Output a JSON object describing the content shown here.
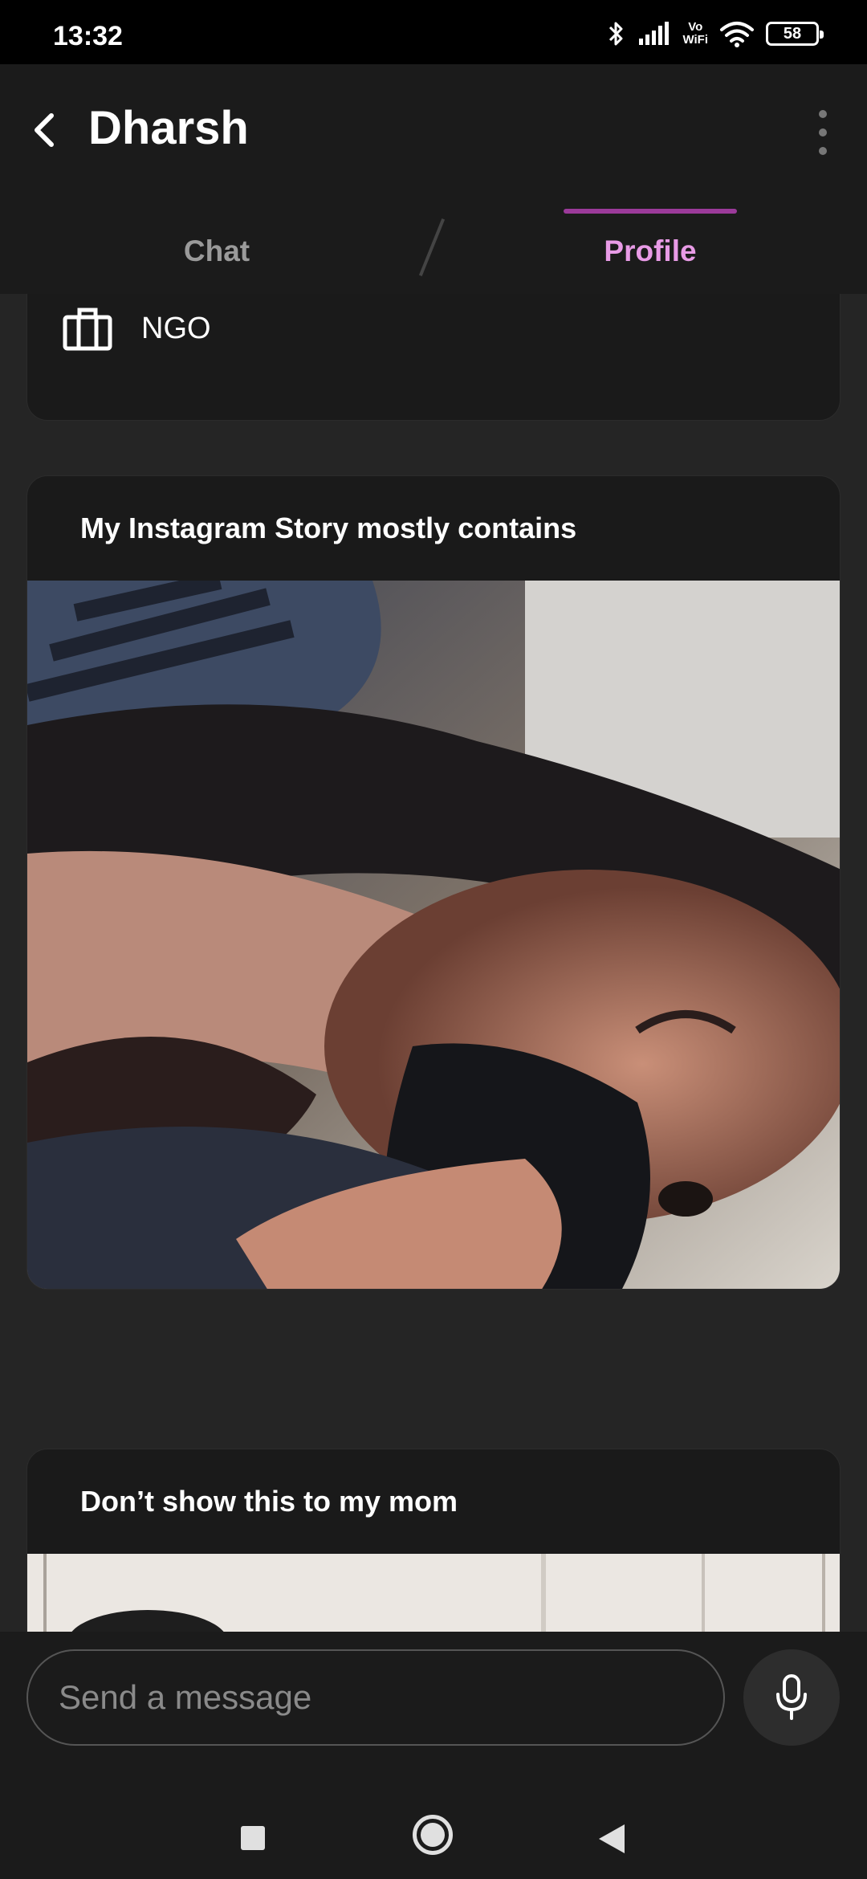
{
  "status_bar": {
    "time": "13:32",
    "vowifi_top": "Vo",
    "vowifi_bottom": "WiFi",
    "battery": "58",
    "icons": [
      "bluetooth-icon",
      "signal-icon",
      "vowifi-icon",
      "wifi-icon",
      "battery-icon"
    ]
  },
  "header": {
    "title": "Dharsh",
    "back_icon": "chevron-left-icon",
    "more_icon": "more-vertical-icon"
  },
  "tabs": [
    {
      "label": "Chat",
      "active": false
    },
    {
      "label": "Profile",
      "active": true
    }
  ],
  "profile": {
    "job": {
      "icon": "briefcase-icon",
      "label": "NGO"
    },
    "prompts": [
      {
        "title": "My Instagram Story mostly contains"
      },
      {
        "title": "Don’t show this to my mom"
      }
    ]
  },
  "composer": {
    "placeholder": "Send a message",
    "mic_icon": "microphone-icon"
  },
  "nav_bar": {
    "icons": [
      "recents-icon",
      "home-icon",
      "back-icon"
    ]
  },
  "colors": {
    "accent": "#e89be6",
    "tab_underline": "#9b3a9a",
    "background": "#252525",
    "header_bg": "#1b1b1b"
  }
}
